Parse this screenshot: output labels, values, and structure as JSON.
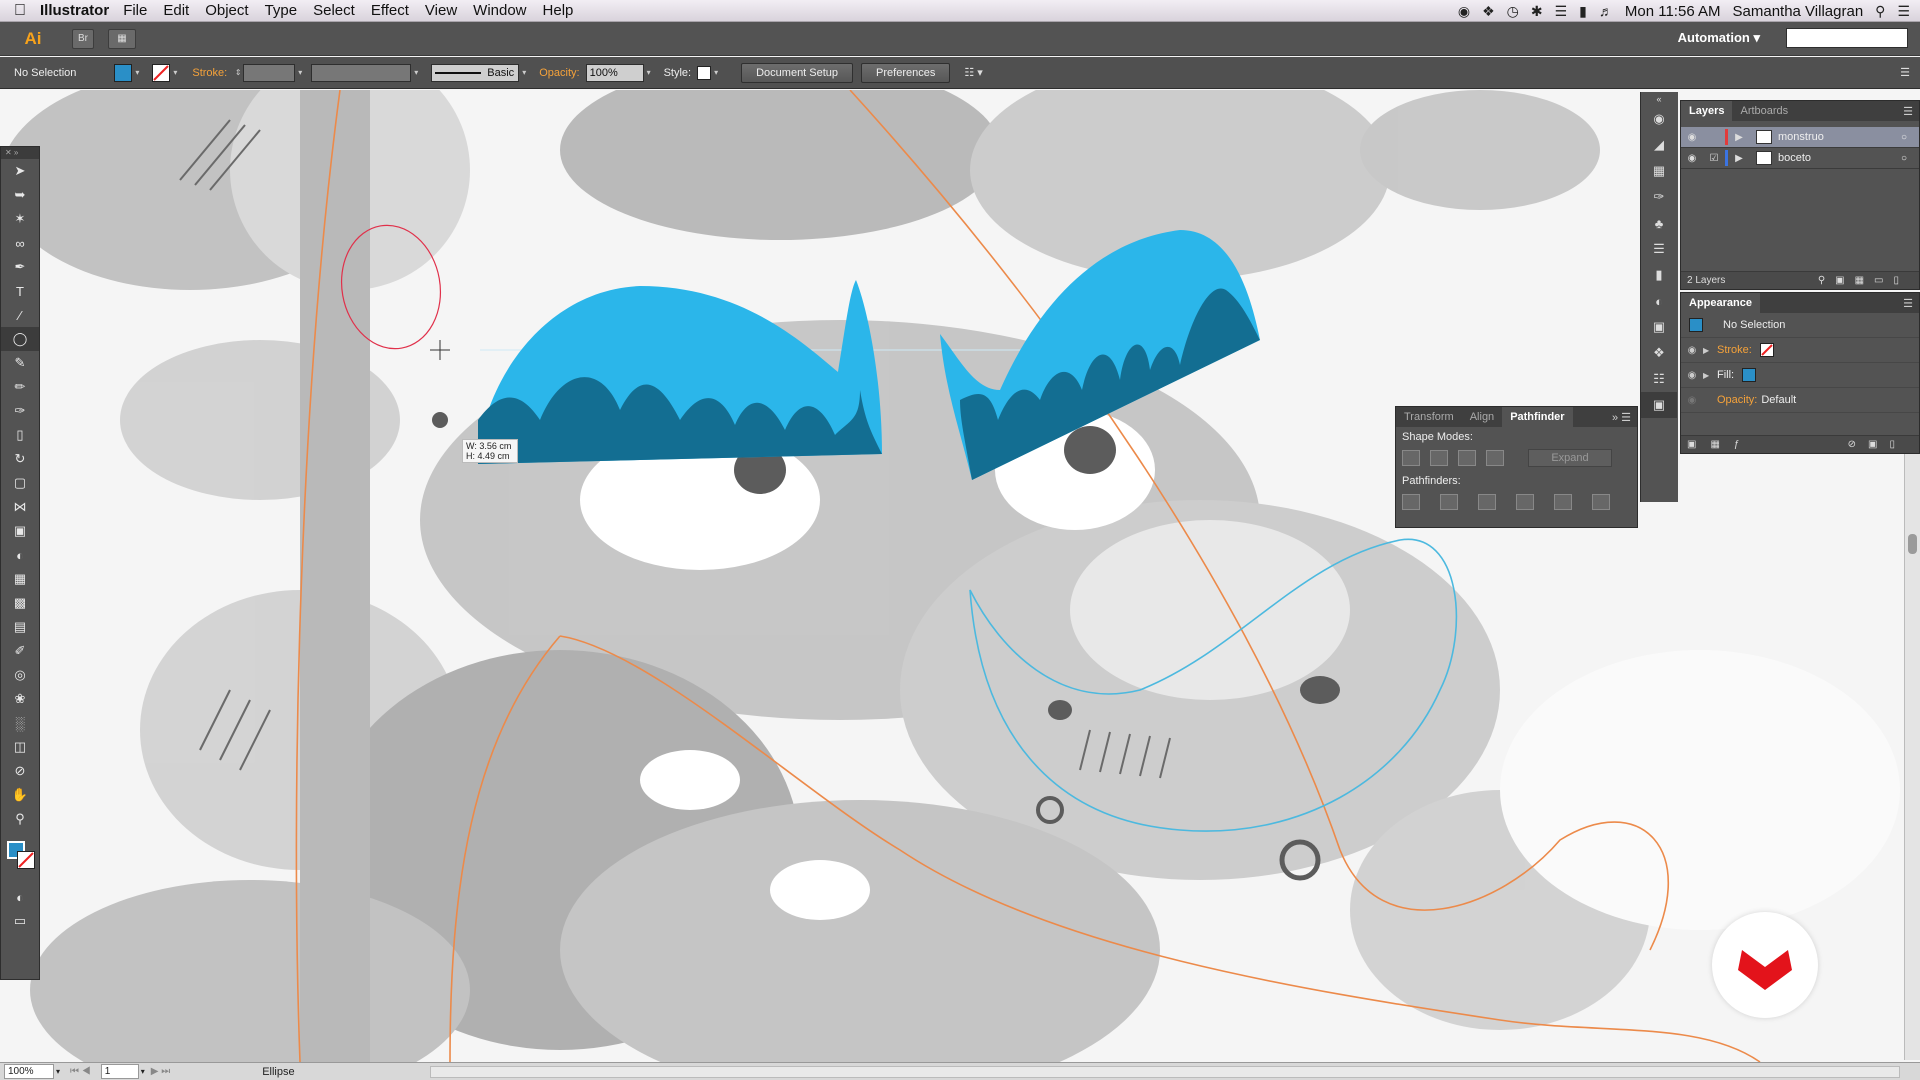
{
  "menubar": {
    "app_name": "Illustrator",
    "menus": [
      "File",
      "Edit",
      "Object",
      "Type",
      "Select",
      "Effect",
      "View",
      "Window",
      "Help"
    ],
    "clock": "Mon 11:56 AM",
    "user": "Samantha Villagran"
  },
  "appbar": {
    "logo": "Ai",
    "bridge_label": "Br",
    "workspace": "Automation"
  },
  "controlbar": {
    "selection": "No Selection",
    "stroke_label": "Stroke:",
    "brush": "Basic",
    "opacity_label": "Opacity:",
    "opacity_value": "100%",
    "style_label": "Style:",
    "document_setup": "Document Setup",
    "preferences": "Preferences",
    "fill_color": "#2a8fc7"
  },
  "canvas": {
    "measure_w": "W: 3.56 cm",
    "measure_h": "H: 4.49 cm",
    "shape_light": "#2bb6ea",
    "shape_dark": "#136e92",
    "guide_color": "#ec8a4a",
    "outline_color": "#4cb9df"
  },
  "layers": {
    "tabs": [
      "Layers",
      "Artboards"
    ],
    "items": [
      {
        "name": "monstruo",
        "selected": true
      },
      {
        "name": "boceto",
        "selected": false
      }
    ],
    "count": "2 Layers"
  },
  "appearance": {
    "title": "Appearance",
    "selection": "No Selection",
    "stroke": "Stroke:",
    "fill": "Fill:",
    "opacity": "Opacity:",
    "opacity_value": "Default"
  },
  "pathfinder": {
    "tabs": [
      "Transform",
      "Align",
      "Pathfinder"
    ],
    "shape_modes": "Shape Modes:",
    "pathfinders": "Pathfinders:",
    "expand": "Expand"
  },
  "status": {
    "zoom": "100%",
    "page": "1",
    "tool": "Ellipse"
  }
}
